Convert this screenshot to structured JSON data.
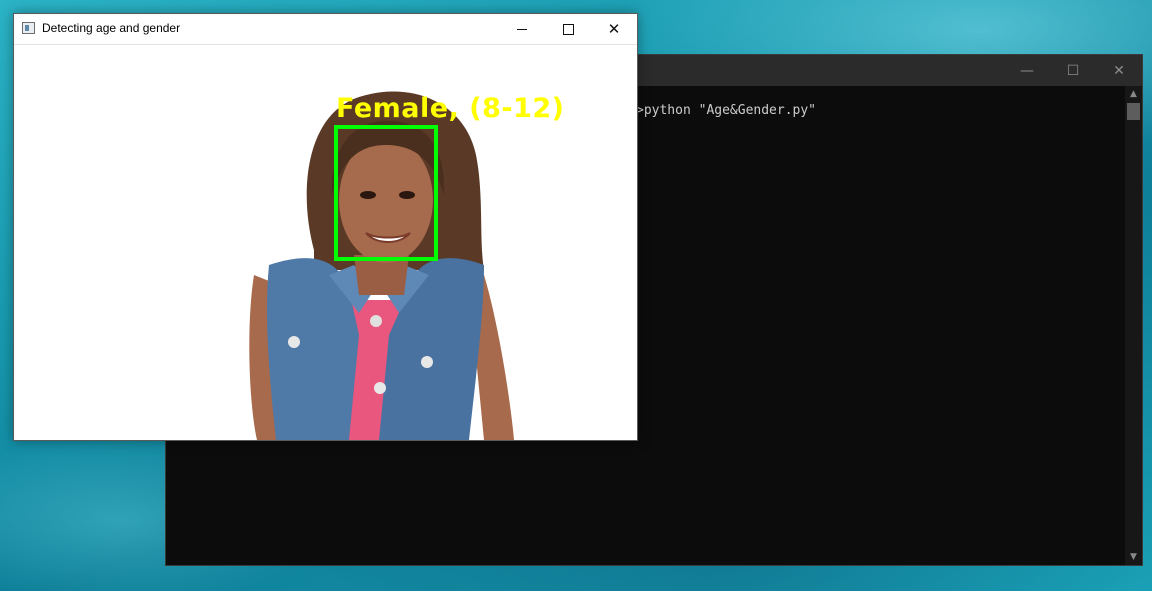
{
  "console": {
    "command": ">python \"Age&Gender.py\"",
    "controls": {
      "minimize": "—",
      "maximize": "☐",
      "close": "✕"
    },
    "scroll_up": "▲",
    "scroll_down": "▼"
  },
  "image_window": {
    "title": "Detecting age and gender",
    "controls": {
      "close": "✕"
    },
    "detection": {
      "label": "Female, (8-12)",
      "label_color": "#ffff00",
      "box_color": "#00ff00"
    }
  }
}
